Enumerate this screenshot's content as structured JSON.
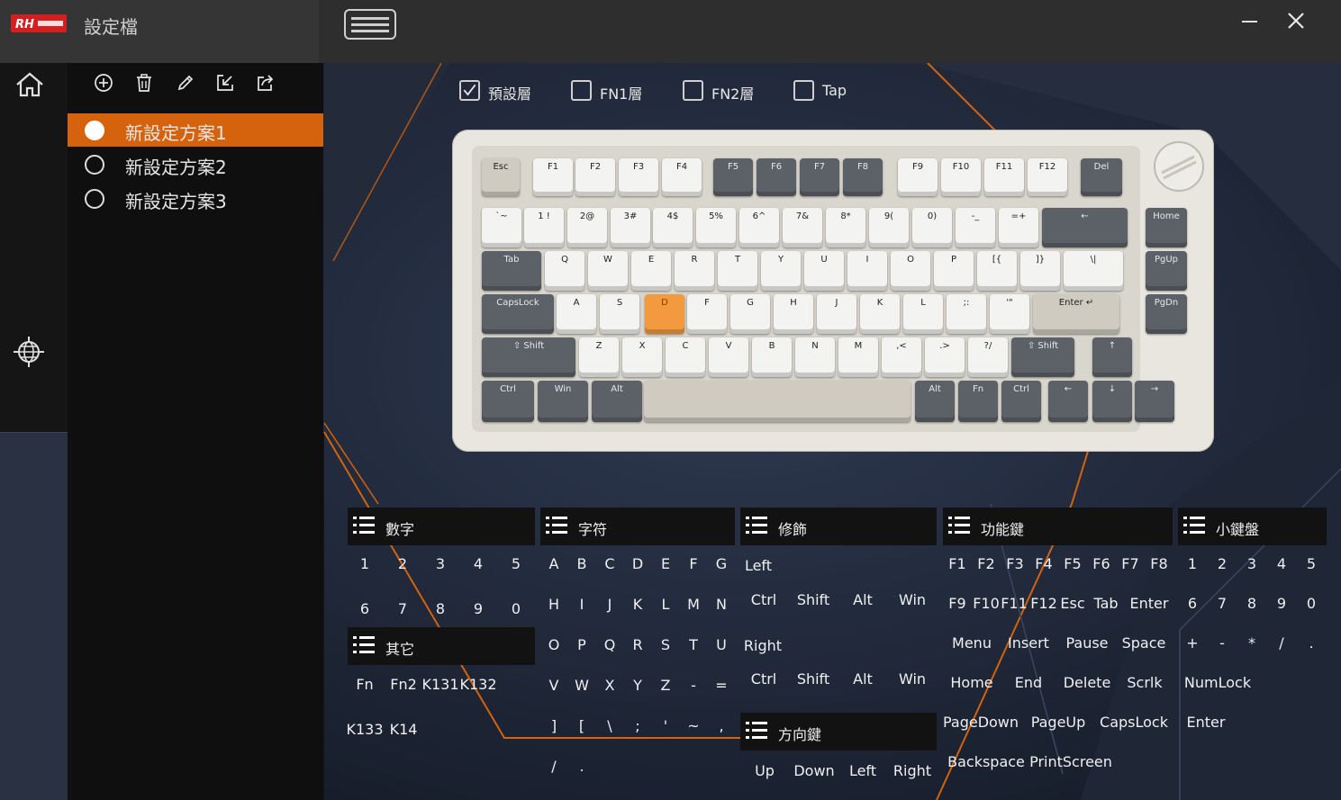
{
  "window": {
    "title": "設定檔"
  },
  "icons": {
    "keyboard": "keyboard-icon",
    "minimize": "minimize-icon",
    "close": "close-icon",
    "home": "home-icon",
    "add": "add-circle-icon",
    "delete": "trash-icon",
    "rename": "pencil-icon",
    "import": "import-icon",
    "export": "export-icon",
    "macro": "globe-network-icon"
  },
  "profiles": [
    {
      "label": "新設定方案1",
      "selected": true
    },
    {
      "label": "新設定方案2",
      "selected": false
    },
    {
      "label": "新設定方案3",
      "selected": false
    }
  ],
  "layers": [
    {
      "label": "預設層",
      "checked": true
    },
    {
      "label": "FN1層",
      "checked": false
    },
    {
      "label": "FN2層",
      "checked": false
    },
    {
      "label": "Tap",
      "checked": false
    }
  ],
  "keyboard": {
    "row0": [
      "Esc",
      "F1",
      "F2",
      "F3",
      "F4",
      "F5",
      "F6",
      "F7",
      "F8",
      "F9",
      "F10",
      "F11",
      "F12",
      "Del"
    ],
    "row1": [
      "`~",
      "1 !",
      "2@",
      "3#",
      "4$",
      "5%",
      "6^",
      "7&",
      "8*",
      "9(",
      "0)",
      "-_",
      "=+",
      "←",
      "Home"
    ],
    "row2": [
      "Tab",
      "Q",
      "W",
      "E",
      "R",
      "T",
      "Y",
      "U",
      "I",
      "O",
      "P",
      "[{",
      "]}",
      "\\|",
      "PgUp"
    ],
    "row3": [
      "CapsLock",
      "A",
      "S",
      "D",
      "F",
      "G",
      "H",
      "J",
      "K",
      "L",
      ";:",
      "'\"",
      "Enter ↵",
      "PgDn"
    ],
    "row4": [
      "⇧ Shift",
      "Z",
      "X",
      "C",
      "V",
      "B",
      "N",
      "M",
      ",<",
      ".>",
      "?/",
      "⇧ Shift",
      "↑"
    ],
    "row5": [
      "Ctrl",
      "Win",
      "Alt",
      "",
      "Alt",
      "Fn",
      "Ctrl",
      "←",
      "↓",
      "→"
    ],
    "highlight": "D"
  },
  "palettes": {
    "digits": {
      "title": "數字",
      "keys": [
        "1",
        "2",
        "3",
        "4",
        "5",
        "6",
        "7",
        "8",
        "9",
        "0"
      ]
    },
    "chars": {
      "title": "字符",
      "keys": [
        "A",
        "B",
        "C",
        "D",
        "E",
        "F",
        "G",
        "H",
        "I",
        "J",
        "K",
        "L",
        "M",
        "N",
        "O",
        "P",
        "Q",
        "R",
        "S",
        "T",
        "U",
        "V",
        "W",
        "X",
        "Y",
        "Z",
        "-",
        "=",
        "]",
        "[",
        "\\",
        ";",
        "'",
        "~",
        ",",
        "/",
        "."
      ]
    },
    "modifiers": {
      "title": "修飾",
      "keys": [
        "Left",
        "Ctrl",
        "Shift",
        "Alt",
        "Win",
        "Right",
        "Ctrl",
        "Shift",
        "Alt",
        "Win"
      ]
    },
    "function": {
      "title": "功能鍵",
      "keys": [
        "F1",
        "F2",
        "F3",
        "F4",
        "F5",
        "F6",
        "F7",
        "F8",
        "F9",
        "F10",
        "F11",
        "F12",
        "Esc",
        "Tab",
        "Enter",
        "Menu",
        "Insert",
        "Pause",
        "Space",
        "Home",
        "End",
        "Delete",
        "Scrlk",
        "NumLock",
        "PageDown",
        "PageUp",
        "CapsLock",
        "Enter",
        "Backspace",
        "PrintScreen"
      ]
    },
    "numpad": {
      "title": "小鍵盤",
      "keys": [
        "1",
        "2",
        "3",
        "4",
        "5",
        "6",
        "7",
        "8",
        "9",
        "0",
        "+",
        "-",
        "*",
        "/",
        "."
      ]
    },
    "others": {
      "title": "其它",
      "keys": [
        "Fn",
        "Fn2",
        "K131",
        "K132",
        "K133",
        "K14"
      ]
    },
    "arrows": {
      "title": "方向鍵",
      "keys": [
        "Up",
        "Down",
        "Left",
        "Right"
      ]
    }
  },
  "colors": {
    "accent": "#d5620c",
    "highlight_key": "#f29a3d",
    "background": "#1c2231"
  }
}
